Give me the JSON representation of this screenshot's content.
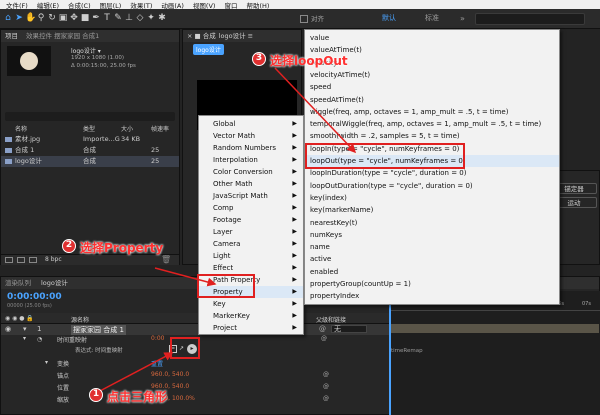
{
  "menubar": [
    "文件(F)",
    "编辑(E)",
    "合成(C)",
    "图层(L)",
    "效果(T)",
    "动画(A)",
    "视图(V)",
    "窗口",
    "帮助(H)"
  ],
  "toolbar": {
    "align_label": "对齐",
    "workspace_default": "默认",
    "workspace_standard": "标准"
  },
  "project_panel": {
    "title": "项目",
    "effects_tab": "效果控件 摆家家园 合成1",
    "comp_name": "logo设计 ▾",
    "comp_info1": "1920 x 1080 (1.00)",
    "comp_info2": "Δ 0:00:15:00, 25.00 fps",
    "col_name": "名称",
    "col_type": "类型",
    "col_size": "大小",
    "col_fps": "帧速率",
    "items": [
      {
        "name": "素材.jpg",
        "type": "Importe...G",
        "size": "34 KB",
        "fps": ""
      },
      {
        "name": "合成 1",
        "type": "合成",
        "size": "",
        "fps": "25"
      },
      {
        "name": "logo设计",
        "type": "合成",
        "size": "",
        "fps": "25"
      }
    ],
    "bpc": "8 bpc"
  },
  "comp_panel": {
    "tab_prefix": "× ■ 合成",
    "tab_name": "logo设计 ≡",
    "subtab": "logo设计"
  },
  "right_panel": {
    "btn1": "锚定器",
    "btn2": "运动"
  },
  "timeline": {
    "tab_render": "渲染队列",
    "tab_comp": "logo设计",
    "timecode": "0:00:00:00",
    "fps_sub": "00000 (25.00 fps)",
    "col_source": "源名称",
    "col_parent": "父级和链接",
    "parent_none": "无",
    "layer_num": "1",
    "layer_name": "摆家家园 合成 1",
    "prop_time_remap": "时间重映射",
    "prop_time_remap_val": "0:00",
    "expr_label": "表达式: 时间重映射",
    "prop_transform": "变换",
    "transform_reset": "重置",
    "prop_anchor": "锚点",
    "anchor_val": "960.0, 540.0",
    "prop_position": "位置",
    "position_val": "960.0, 540.0",
    "prop_scale": "缩放",
    "scale_val": "100.0, 100.0%",
    "expr_text": "timeRemap",
    "ruler_ticks": [
      "00s",
      "01s",
      "02s",
      "03s",
      "04s",
      "05s",
      "06s",
      "07s"
    ]
  },
  "expr_menu_items": [
    "Global",
    "Vector Math",
    "Random Numbers",
    "Interpolation",
    "Color Conversion",
    "Other Math",
    "JavaScript Math",
    "Comp",
    "Footage",
    "Layer",
    "Camera",
    "Light",
    "Effect",
    "Path Property",
    "Property",
    "Key",
    "MarkerKey",
    "Project"
  ],
  "property_submenu_items": [
    "value",
    "valueAtTime(t)",
    "velocity",
    "velocityAtTime(t)",
    "speed",
    "speedAtTime(t)",
    "wiggle(freq, amp, octaves = 1, amp_mult = .5, t = time)",
    "temporalWiggle(freq, amp, octaves = 1, amp_mult = .5, t = time)",
    "smooth(width = .2, samples = 5, t = time)",
    "loopIn(type = \"cycle\", numKeyframes = 0)",
    "loopOut(type = \"cycle\", numKeyframes = 0)",
    "loopInDuration(type = \"cycle\", duration = 0)",
    "loopOutDuration(type = \"cycle\", duration = 0)",
    "key(index)",
    "key(markerName)",
    "nearestKey(t)",
    "numKeys",
    "name",
    "active",
    "enabled",
    "propertyGroup(countUp = 1)",
    "propertyIndex"
  ],
  "annotations": {
    "step1_num": "1",
    "step1_text": "点击三角形",
    "step2_num": "2",
    "step2_text": "选择Property",
    "step3_num": "3",
    "step3_text": "选择loopOut"
  },
  "colors": {
    "accent_blue": "#4aa3ff",
    "annotation_red": "#e02020",
    "menu_bg": "#f2f2f2",
    "highlight": "#dbe8f6"
  }
}
